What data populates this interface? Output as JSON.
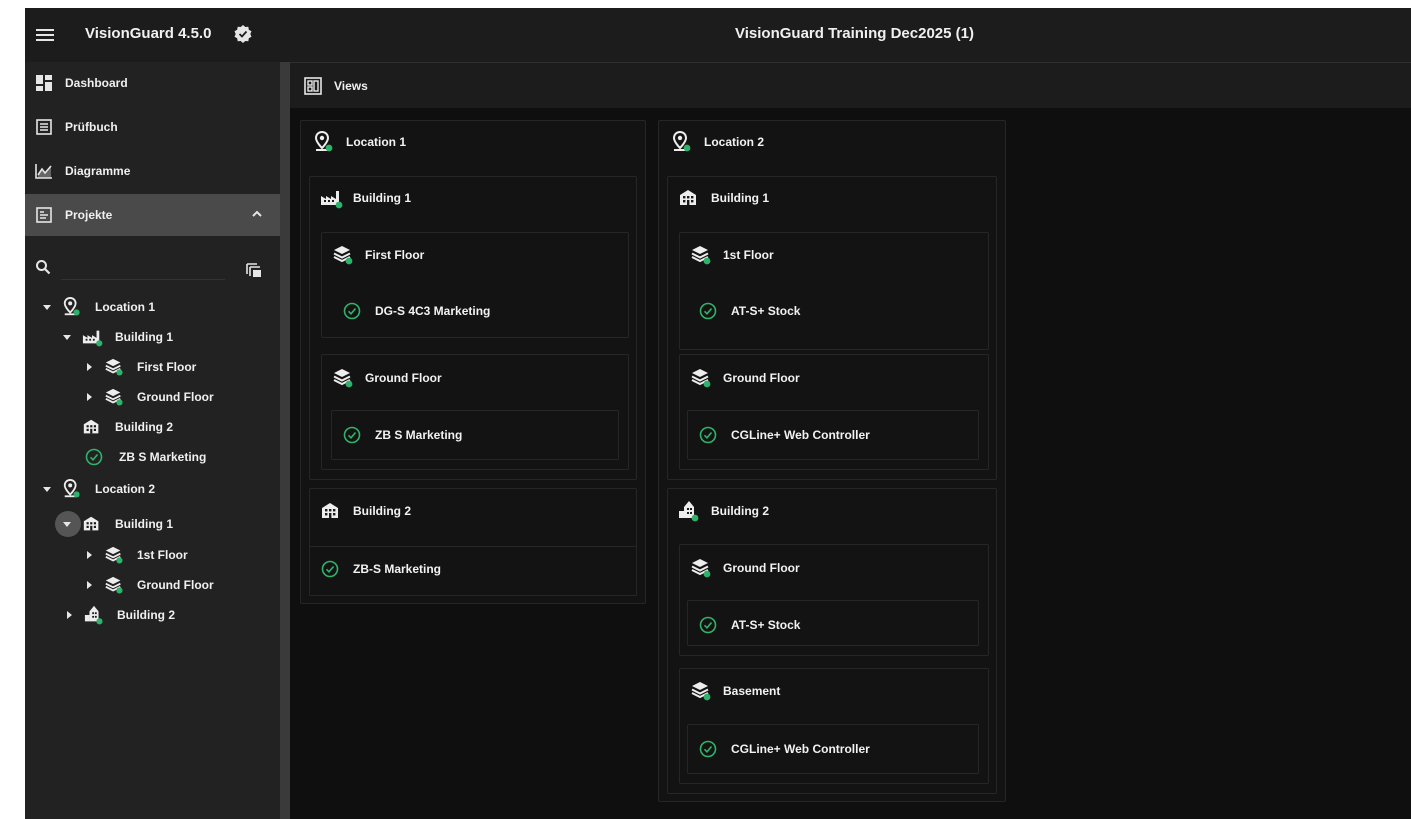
{
  "topbar": {
    "app_title": "VisionGuard 4.5.0",
    "project_title": "VisionGuard Training Dec2025 (1)"
  },
  "sidebar": {
    "nav": [
      {
        "label": "Dashboard",
        "icon": "dashboard-icon"
      },
      {
        "label": "Prüfbuch",
        "icon": "book-icon"
      },
      {
        "label": "Diagramme",
        "icon": "chart-icon"
      },
      {
        "label": "Projekte",
        "icon": "projects-icon",
        "active": true,
        "expanded": true
      }
    ],
    "search": {
      "value": "",
      "placeholder": ""
    },
    "tree": [
      {
        "label": "Location 1",
        "type": "location",
        "toggle": "expanded"
      },
      {
        "label": "Building 1",
        "type": "factory",
        "toggle": "expanded"
      },
      {
        "label": "First Floor",
        "type": "floor",
        "toggle": "collapsed"
      },
      {
        "label": "Ground Floor",
        "type": "floor",
        "toggle": "collapsed"
      },
      {
        "label": "Building 2",
        "type": "building",
        "toggle": "none"
      },
      {
        "label": "ZB S Marketing",
        "type": "device",
        "toggle": "none"
      },
      {
        "label": "Location 2",
        "type": "location",
        "toggle": "expanded"
      },
      {
        "label": "Building 1",
        "type": "building",
        "toggle": "expanded"
      },
      {
        "label": "1st Floor",
        "type": "floor",
        "toggle": "collapsed"
      },
      {
        "label": "Ground Floor",
        "type": "floor",
        "toggle": "collapsed"
      },
      {
        "label": "Building 2",
        "type": "tower",
        "toggle": "collapsed"
      }
    ]
  },
  "views": {
    "label": "Views"
  },
  "locations": [
    {
      "label": "Location 1",
      "b1": "Building 1",
      "b1_floor1": "First Floor",
      "b1_floor1_device": "DG-S 4C3 Marketing",
      "b1_floor2": "Ground Floor",
      "b1_floor2_device": "ZB S Marketing",
      "b2": "Building 2",
      "b2_device": "ZB-S Marketing"
    },
    {
      "label": "Location 2",
      "b1": "Building 1",
      "b1_floor1": "1st Floor",
      "b1_floor1_device": "AT-S+ Stock",
      "b1_floor2": "Ground Floor",
      "b1_floor2_device": "CGLine+ Web Controller",
      "b2": "Building 2",
      "b2_floor1": "Ground Floor",
      "b2_floor1_device": "AT-S+ Stock",
      "b2_floor2": "Basement",
      "b2_floor2_device": "CGLine+ Web Controller"
    }
  ],
  "colors": {
    "background": "#0f0f0f",
    "topbar": "#1c1c1c",
    "sidebar": "#222222",
    "active_nav": "#4a4a4a",
    "accent_green": "#2fb36b",
    "text": "#f0f0f0"
  }
}
